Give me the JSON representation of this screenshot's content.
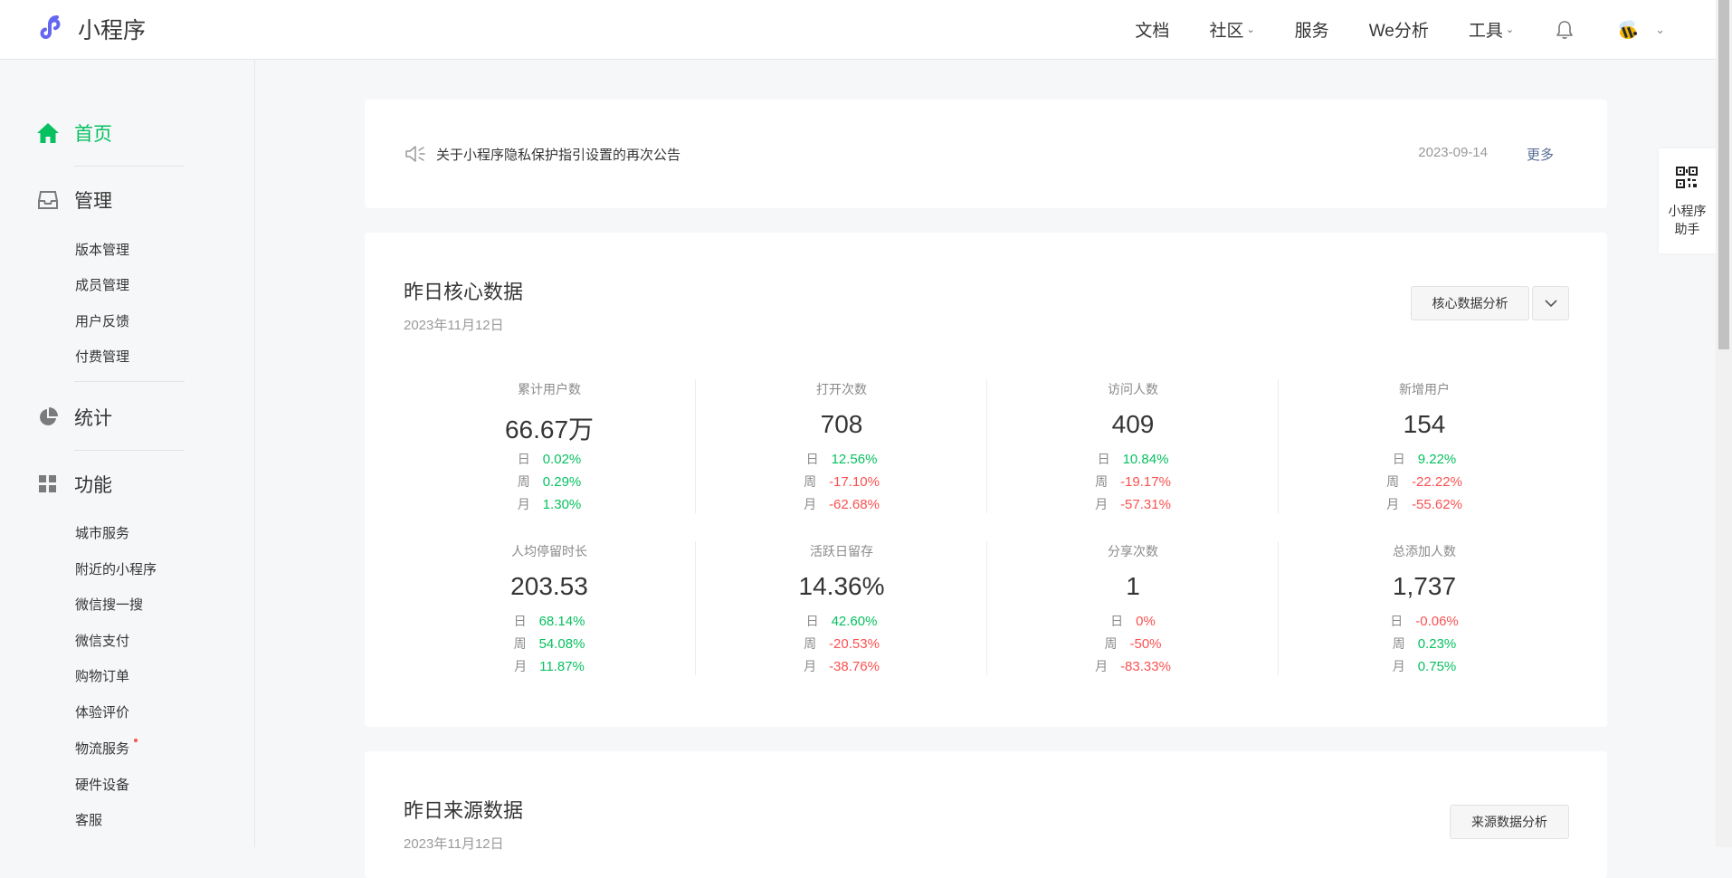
{
  "header": {
    "app_title": "小程序",
    "nav": [
      {
        "label": "文档",
        "dropdown": false
      },
      {
        "label": "社区",
        "dropdown": true
      },
      {
        "label": "服务",
        "dropdown": false
      },
      {
        "label": "We分析",
        "dropdown": false
      },
      {
        "label": "工具",
        "dropdown": true
      }
    ],
    "bell_icon": "bell-icon",
    "avatar_icon": "bee-avatar"
  },
  "sidebar": {
    "home": "首页",
    "manage": "管理",
    "manage_items": [
      "版本管理",
      "成员管理",
      "用户反馈",
      "付费管理"
    ],
    "stats": "统计",
    "features": "功能",
    "feature_items": [
      "城市服务",
      "附近的小程序",
      "微信搜一搜",
      "微信支付",
      "购物订单",
      "体验评价",
      "物流服务",
      "硬件设备",
      "客服"
    ],
    "active_color": "#07c160"
  },
  "notice": {
    "text": "关于小程序隐私保护指引设置的再次公告",
    "date": "2023-09-14",
    "more": "更多"
  },
  "core": {
    "title": "昨日核心数据",
    "date": "2023年11月12日",
    "analysis_button": "核心数据分析",
    "period_labels": [
      "日",
      "周",
      "月"
    ],
    "metrics": [
      {
        "label": "累计用户数",
        "value": "66.67万",
        "changes": [
          "0.02%",
          "0.29%",
          "1.30%"
        ],
        "dirs": [
          "up",
          "up",
          "up"
        ]
      },
      {
        "label": "打开次数",
        "value": "708",
        "changes": [
          "12.56%",
          "-17.10%",
          "-62.68%"
        ],
        "dirs": [
          "up",
          "down",
          "down"
        ]
      },
      {
        "label": "访问人数",
        "value": "409",
        "changes": [
          "10.84%",
          "-19.17%",
          "-57.31%"
        ],
        "dirs": [
          "up",
          "down",
          "down"
        ]
      },
      {
        "label": "新增用户",
        "value": "154",
        "changes": [
          "9.22%",
          "-22.22%",
          "-55.62%"
        ],
        "dirs": [
          "up",
          "down",
          "down"
        ]
      },
      {
        "label": "人均停留时长",
        "value": "203.53",
        "changes": [
          "68.14%",
          "54.08%",
          "11.87%"
        ],
        "dirs": [
          "up",
          "up",
          "up"
        ]
      },
      {
        "label": "活跃日留存",
        "value": "14.36%",
        "changes": [
          "42.60%",
          "-20.53%",
          "-38.76%"
        ],
        "dirs": [
          "up",
          "down",
          "down"
        ]
      },
      {
        "label": "分享次数",
        "value": "1",
        "changes": [
          "0%",
          "-50%",
          "-83.33%"
        ],
        "dirs": [
          "down",
          "down",
          "down"
        ]
      },
      {
        "label": "总添加人数",
        "value": "1,737",
        "changes": [
          "-0.06%",
          "0.23%",
          "0.75%"
        ],
        "dirs": [
          "down",
          "up",
          "up"
        ]
      }
    ],
    "colors": {
      "up": "#07c160",
      "down": "#fa5151"
    }
  },
  "source": {
    "title": "昨日来源数据",
    "date": "2023年11月12日",
    "analysis_button": "来源数据分析"
  },
  "helper": {
    "line1": "小程序",
    "line2": "助手"
  }
}
